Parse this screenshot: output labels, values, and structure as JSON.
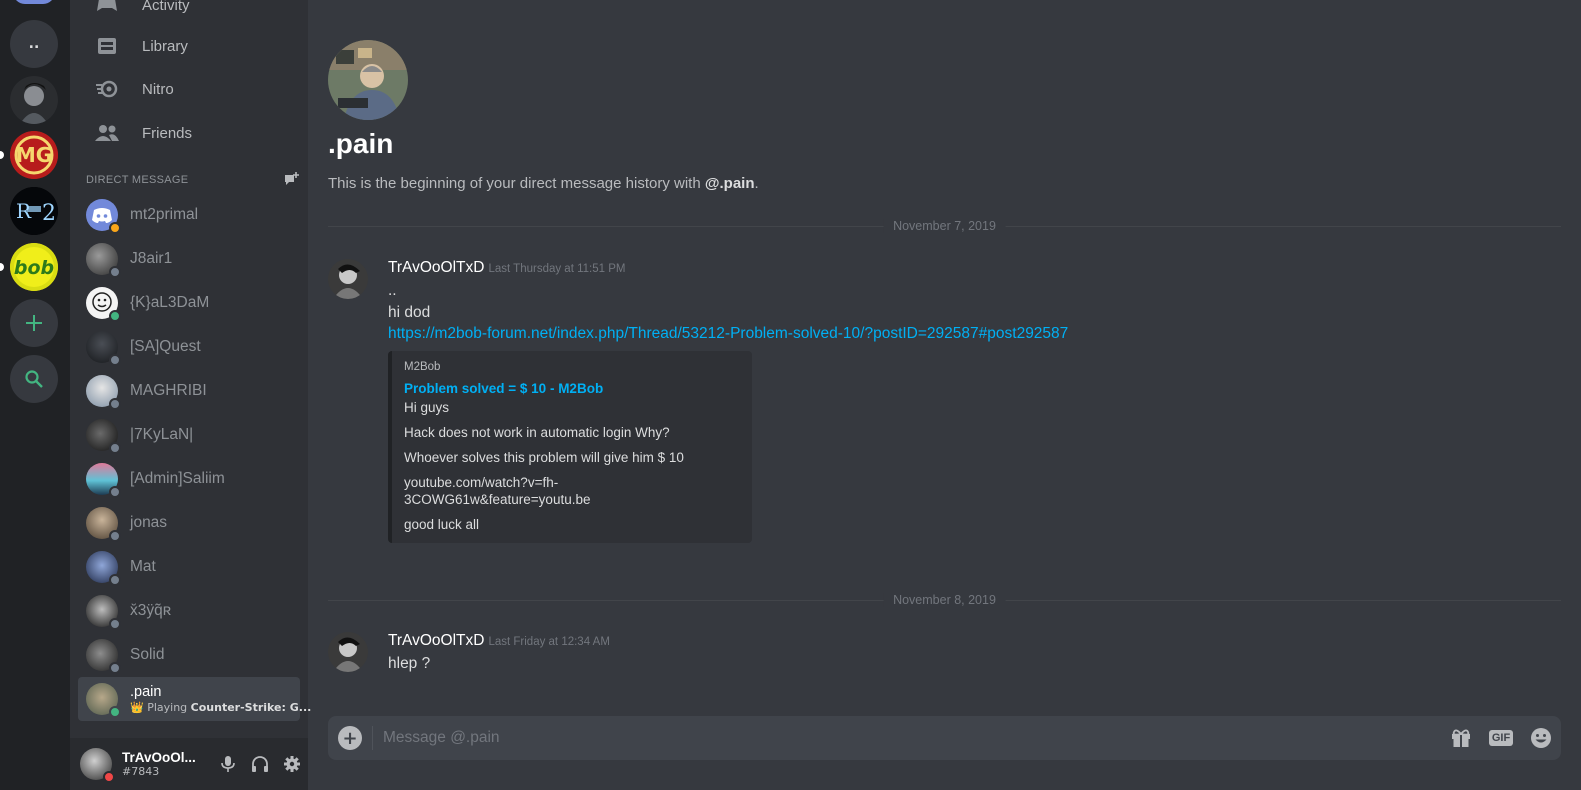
{
  "server_rail": {
    "dots_label": "..",
    "servers": [
      "server-portrait",
      "server-mg-logo",
      "server-metin2",
      "server-bob"
    ]
  },
  "nav": {
    "activity": "Activity",
    "library": "Library",
    "nitro": "Nitro",
    "friends": "Friends"
  },
  "dm_header": "DIRECT MESSAGE",
  "dms": [
    {
      "name": "mt2primal",
      "status": "idle"
    },
    {
      "name": "J8air1",
      "status": "offline"
    },
    {
      "name": "{K}aL3DaM",
      "status": "online"
    },
    {
      "name": "[SA]Quest",
      "status": "offline"
    },
    {
      "name": "MAGHRIBI",
      "status": "offline"
    },
    {
      "name": "|7KyLaN|",
      "status": "offline"
    },
    {
      "name": "[Admin]Saliim",
      "status": "offline"
    },
    {
      "name": "jonas",
      "status": "offline"
    },
    {
      "name": "Mat",
      "status": "offline"
    },
    {
      "name": "x̆3ÿq̃ʀ",
      "status": "offline"
    },
    {
      "name": "Solid",
      "status": "offline"
    }
  ],
  "active_dm": {
    "name": ".pain",
    "activity_prefix": "Playing ",
    "activity_game": "Counter-Strike: G..."
  },
  "user": {
    "name": "TrAvOoOl...",
    "tag": "#7843"
  },
  "chat": {
    "title": ".pain",
    "intro_prefix": "This is the beginning of your direct message history with ",
    "intro_mention": "@.pain",
    "intro_suffix": ".",
    "divider1": "November 7, 2019",
    "divider2": "November 8, 2019",
    "msg1": {
      "author": "TrAvOoOlTxD",
      "time": "Last Thursday at 11:51 PM",
      "lines": [
        "..",
        "hi dod"
      ],
      "link": "https://m2bob-forum.net/index.php/Thread/53212-Problem-solved-10/?postID=292587#post292587"
    },
    "embed": {
      "provider": "M2Bob",
      "title": "Problem solved = $ 10 - M2Bob",
      "paragraphs": [
        "Hi guys",
        "Hack does not work in automatic login Why?",
        "Whoever solves this problem will give him $ 10",
        "youtube.com/watch?v=fh-3COWG61w&feature=youtu.be",
        "good luck all"
      ]
    },
    "msg2": {
      "author": "TrAvOoOlTxD",
      "time": "Last Friday at 12:34 AM",
      "line": "hlep ?"
    }
  },
  "composer": {
    "placeholder": "Message @.pain",
    "gif_label": "GIF"
  },
  "colors": {
    "accent": "#7289da",
    "link": "#00b0f4",
    "online": "#43b581",
    "idle": "#faa61a",
    "dnd": "#f04747"
  }
}
